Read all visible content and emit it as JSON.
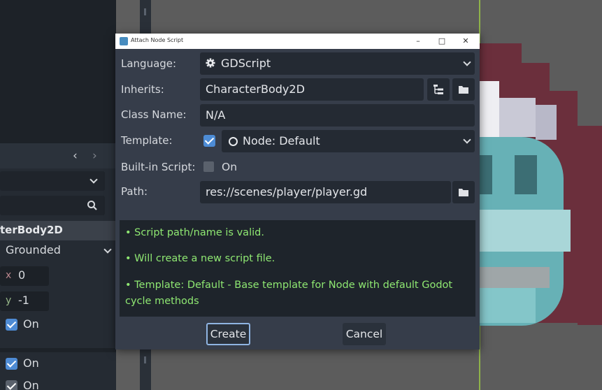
{
  "inspector": {
    "class_header": "terBody2D",
    "motion_mode": "Grounded",
    "up_direction": {
      "x": "0",
      "y": "-1"
    },
    "checks": [
      {
        "label": "On"
      },
      {
        "label": "On"
      },
      {
        "label": "On"
      }
    ]
  },
  "dialog": {
    "title": "Attach Node Script",
    "window_buttons": {
      "minimize": "–",
      "maximize": "□",
      "close": "✕"
    },
    "form": {
      "language_label": "Language:",
      "language_value": "GDScript",
      "inherits_label": "Inherits:",
      "inherits_value": "CharacterBody2D",
      "class_name_label": "Class Name:",
      "class_name_value": "N/A",
      "template_label": "Template:",
      "template_checked": true,
      "template_value": "Node: Default",
      "builtin_label": "Built-in Script:",
      "builtin_checked": false,
      "builtin_value": "On",
      "path_label": "Path:",
      "path_value": "res://scenes/player/player.gd"
    },
    "messages": [
      "• Script path/name is valid.",
      "• Will create a new script file.",
      "• Template: Default - Base template for Node with default Godot cycle methods"
    ],
    "buttons": {
      "create": "Create",
      "cancel": "Cancel"
    }
  },
  "colors": {
    "dialog_bg": "#363d4a",
    "field_bg": "#242a33",
    "accent": "#4d8cd6",
    "message_text": "#8fe872",
    "focus_border": "#8fb4e2"
  },
  "icons": [
    "gear-icon",
    "chevron-down-icon",
    "tree-icon",
    "folder-icon",
    "node-circle-icon",
    "checkbox-icon",
    "search-icon",
    "chevron-left-icon",
    "chevron-right-icon"
  ]
}
